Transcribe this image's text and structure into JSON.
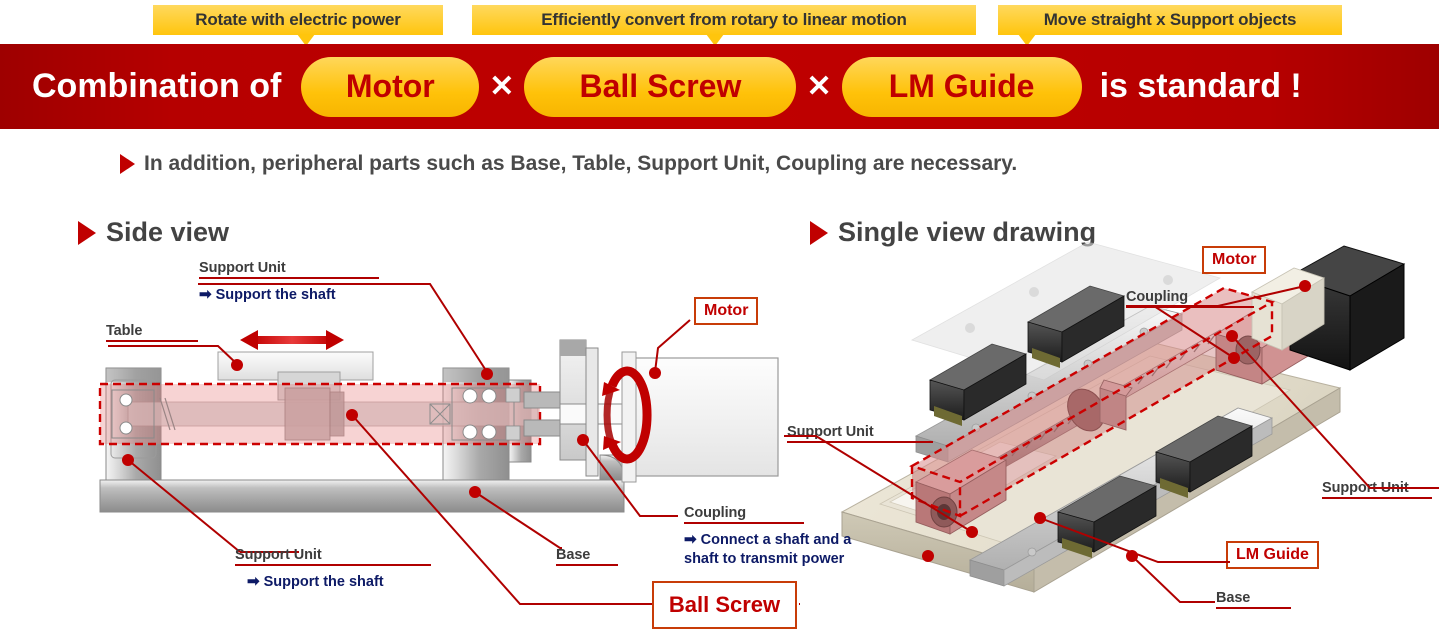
{
  "callouts": [
    {
      "id": "motor-callout",
      "text": "Rotate with electric power"
    },
    {
      "id": "ballscrew-callout",
      "text": "Efficiently convert from rotary to linear motion"
    },
    {
      "id": "lmguide-callout",
      "text": "Move straight x Support objects"
    }
  ],
  "banner": {
    "prefix": "Combination of",
    "pill1": "Motor",
    "sep1": "✕",
    "pill2": "Ball Screw",
    "sep2": "✕",
    "pill3": "LM Guide",
    "suffix": "is standard !",
    "bg_color": "#c00000",
    "pill_color": "#ffc50d",
    "pill_text_color": "#c00000"
  },
  "note": "In addition, peripheral parts such as Base, Table, Support Unit, Coupling are necessary.",
  "views": {
    "left_title": "Side view",
    "right_title": "Single view drawing"
  },
  "side_view_labels": {
    "support_unit_top": "Support Unit",
    "support_unit_top_sub": "Support the shaft",
    "table": "Table",
    "motor_box": "Motor",
    "support_unit_bottom": "Support Unit",
    "support_unit_bottom_sub": "Support the shaft",
    "base": "Base",
    "coupling": "Coupling",
    "coupling_sub_line1": "Connect a shaft and a",
    "coupling_sub_line2": "shaft to transmit power",
    "ball_screw_box": "Ball Screw"
  },
  "single_view_labels": {
    "motor_box": "Motor",
    "coupling": "Coupling",
    "support_unit_left": "Support Unit",
    "support_unit_right": "Support Unit",
    "lm_guide_box": "LM Guide",
    "base": "Base"
  },
  "icons": {
    "triangle_bullet": "triangle-bullet-icon",
    "arrow_right": "➡",
    "double_arrow": "double-arrow-icon",
    "rotation_arrow": "rotation-arrow-icon"
  },
  "colors": {
    "banner_red": "#c00000",
    "accent_yellow": "#ffc50d",
    "leader_red": "#b00000",
    "navy": "#0d1a66",
    "gray_text": "#434343",
    "highlight_pink": "rgba(232,120,120,0.38)"
  }
}
